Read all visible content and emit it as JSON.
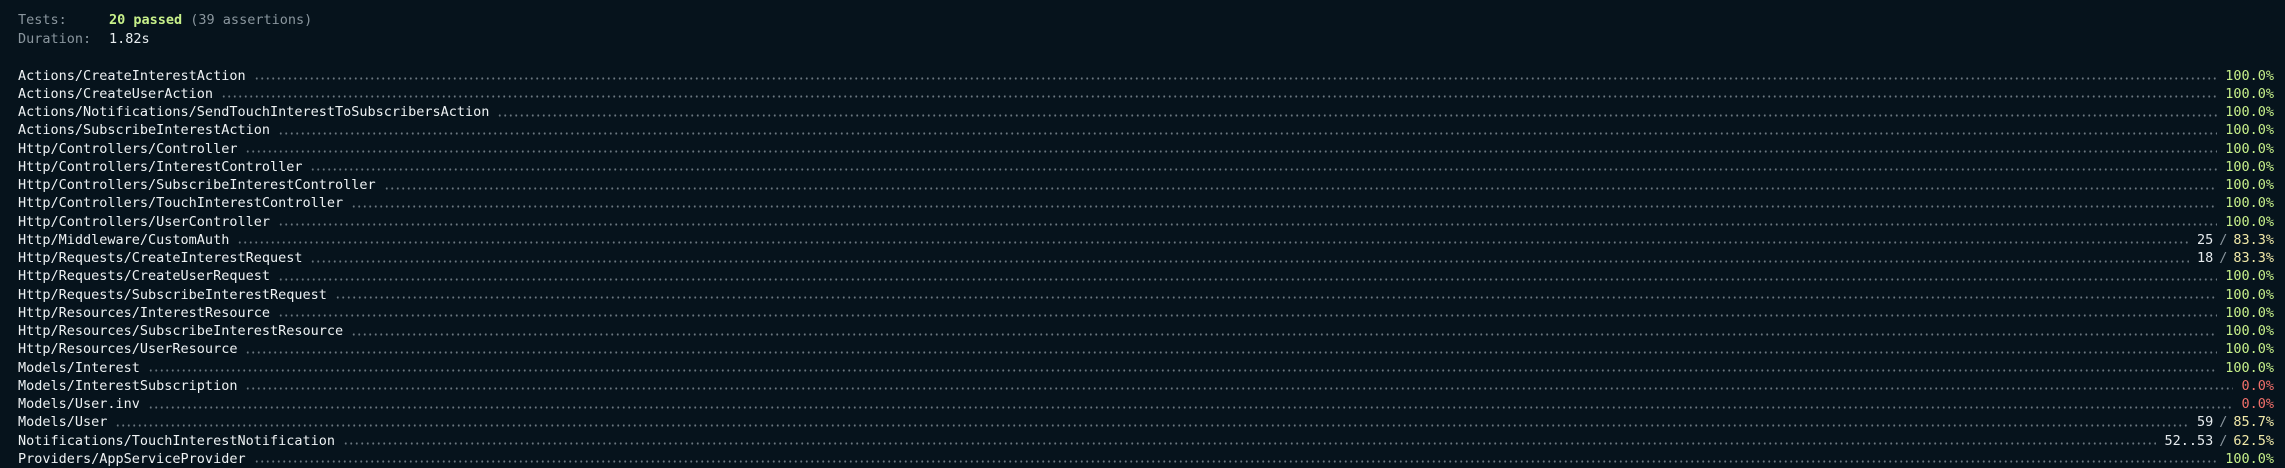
{
  "summary": {
    "tests_label": "Tests:",
    "tests_passed": "20 passed",
    "tests_assertions": "(39 assertions)",
    "duration_label": "Duration:",
    "duration_value": "1.82s"
  },
  "colors": {
    "background": "#06131c",
    "full": "#c7f08a",
    "partial": "#f1e9a8",
    "zero": "#f2706a",
    "muted": "#8a969e"
  },
  "coverage": [
    {
      "name": "Actions/CreateInterestAction",
      "lines": "",
      "percent": "100.0%",
      "status": "full"
    },
    {
      "name": "Actions/CreateUserAction",
      "lines": "",
      "percent": "100.0%",
      "status": "full"
    },
    {
      "name": "Actions/Notifications/SendTouchInterestToSubscribersAction",
      "lines": "",
      "percent": "100.0%",
      "status": "full"
    },
    {
      "name": "Actions/SubscribeInterestAction",
      "lines": "",
      "percent": "100.0%",
      "status": "full"
    },
    {
      "name": "Http/Controllers/Controller",
      "lines": "",
      "percent": "100.0%",
      "status": "full"
    },
    {
      "name": "Http/Controllers/InterestController",
      "lines": "",
      "percent": "100.0%",
      "status": "full"
    },
    {
      "name": "Http/Controllers/SubscribeInterestController",
      "lines": "",
      "percent": "100.0%",
      "status": "full"
    },
    {
      "name": "Http/Controllers/TouchInterestController",
      "lines": "",
      "percent": "100.0%",
      "status": "full"
    },
    {
      "name": "Http/Controllers/UserController",
      "lines": "",
      "percent": "100.0%",
      "status": "full"
    },
    {
      "name": "Http/Middleware/CustomAuth",
      "lines": "25",
      "percent": "83.3%",
      "status": "partial"
    },
    {
      "name": "Http/Requests/CreateInterestRequest",
      "lines": "18",
      "percent": "83.3%",
      "status": "partial"
    },
    {
      "name": "Http/Requests/CreateUserRequest",
      "lines": "",
      "percent": "100.0%",
      "status": "full"
    },
    {
      "name": "Http/Requests/SubscribeInterestRequest",
      "lines": "",
      "percent": "100.0%",
      "status": "full"
    },
    {
      "name": "Http/Resources/InterestResource",
      "lines": "",
      "percent": "100.0%",
      "status": "full"
    },
    {
      "name": "Http/Resources/SubscribeInterestResource",
      "lines": "",
      "percent": "100.0%",
      "status": "full"
    },
    {
      "name": "Http/Resources/UserResource",
      "lines": "",
      "percent": "100.0%",
      "status": "full"
    },
    {
      "name": "Models/Interest",
      "lines": "",
      "percent": "100.0%",
      "status": "full"
    },
    {
      "name": "Models/InterestSubscription",
      "lines": "",
      "percent": "0.0%",
      "status": "zero"
    },
    {
      "name": "Models/User.inv",
      "lines": "",
      "percent": "0.0%",
      "status": "zero"
    },
    {
      "name": "Models/User",
      "lines": "59",
      "percent": "85.7%",
      "status": "partial"
    },
    {
      "name": "Notifications/TouchInterestNotification",
      "lines": "52..53",
      "percent": "62.5%",
      "status": "partial"
    },
    {
      "name": "Providers/AppServiceProvider",
      "lines": "",
      "percent": "100.0%",
      "status": "full"
    }
  ]
}
